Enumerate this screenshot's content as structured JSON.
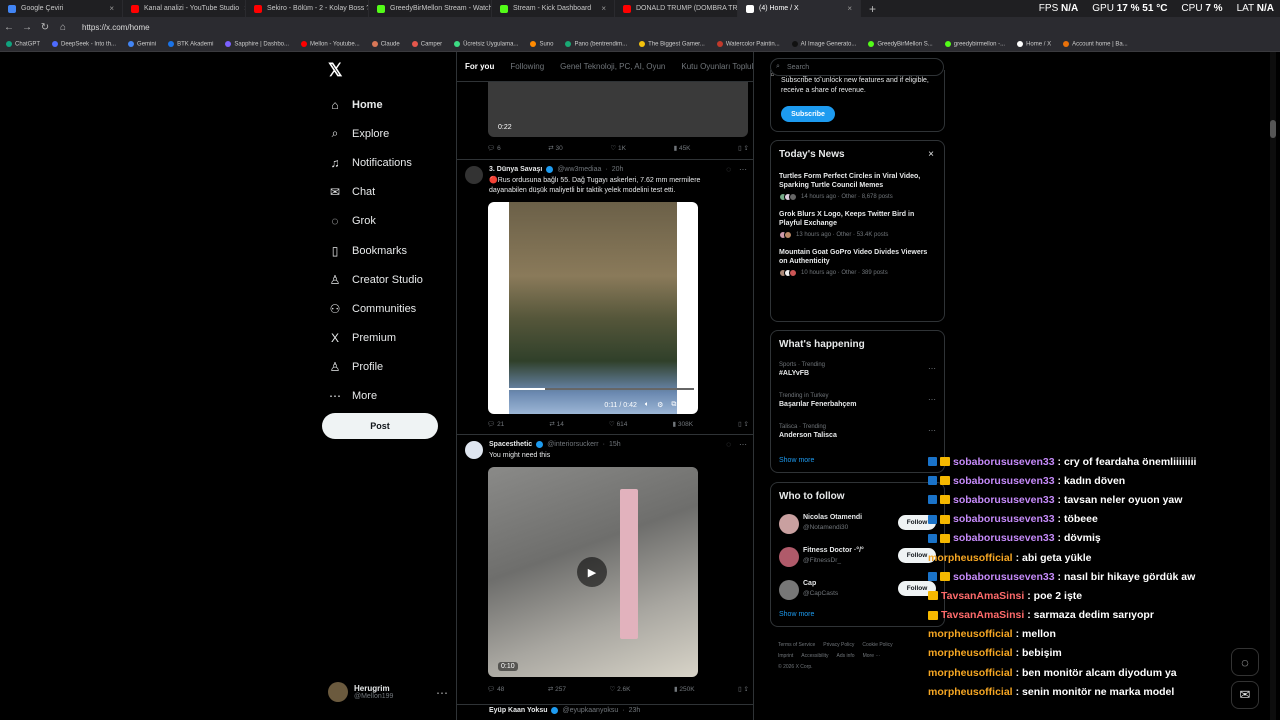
{
  "browser": {
    "tabs": [
      {
        "label": "Google Çeviri",
        "color": "#4285f4"
      },
      {
        "label": "Kanal analizi - YouTube Studio",
        "color": "#ff0000"
      },
      {
        "label": "Sekiro - Bölüm - 2 - Kolay Boss ??",
        "color": "#ff0000"
      },
      {
        "label": "GreedyBirMellon Stream - Watch",
        "color": "#53fc18"
      },
      {
        "label": "Stream - Kick Dashboard",
        "color": "#53fc18"
      },
      {
        "label": "DONALD TRUMP (DOMBRA TRAP",
        "color": "#ff0000"
      },
      {
        "label": "(4) Home / X",
        "color": "#ffffff"
      }
    ],
    "new_tab": "+",
    "url": "https://x.com/home",
    "sys": {
      "fps_label": "FPS",
      "fps": "N/A",
      "gpu_label": "GPU",
      "gpu": "17 % 51 °C",
      "cpu_label": "CPU",
      "cpu": "7 %",
      "lat_label": "LAT",
      "lat": "N/A"
    },
    "bookmarks": [
      "ChatGPT",
      "DeepSeek - Into th...",
      "Gemini",
      "BTK Akademi",
      "Sapphire | Dashbo...",
      "Mellon - Youtube...",
      "Claude",
      "Camper",
      "Ücretsiz Uygulama...",
      "Suno",
      "Pano (bentrendim...",
      "The Biggest Gamer...",
      "Watercolor Paintin...",
      "AI Image Generato...",
      "GreedyBirMellon S...",
      "greedybirmellon -...",
      "Home / X",
      "Account home | Ba..."
    ]
  },
  "sidebar": {
    "items": [
      {
        "label": "Home",
        "icon": "⌂"
      },
      {
        "label": "Explore",
        "icon": "⌕"
      },
      {
        "label": "Notifications",
        "icon": "♫"
      },
      {
        "label": "Chat",
        "icon": "✉"
      },
      {
        "label": "Grok",
        "icon": "◌"
      },
      {
        "label": "Bookmarks",
        "icon": "▯"
      },
      {
        "label": "Creator Studio",
        "icon": "♙"
      },
      {
        "label": "Communities",
        "icon": "⚇"
      },
      {
        "label": "Premium",
        "icon": "X"
      },
      {
        "label": "Profile",
        "icon": "♙"
      },
      {
        "label": "More",
        "icon": "⋯"
      }
    ],
    "post_label": "Post",
    "account": {
      "name": "Herugrim",
      "handle": "@Mellon199"
    }
  },
  "feed": {
    "tabs": [
      "For you",
      "Following",
      "Genel Teknoloji, PC, AI, Oyun",
      "Kutu Oyunları Topluluğu"
    ],
    "top": {
      "time": "0:22",
      "replies": "6",
      "reposts": "30",
      "likes": "1K",
      "views": "45K"
    },
    "t1": {
      "name": "3. Dünya Savaşı",
      "handle": "@ww3mediaa",
      "time": "20h",
      "text": "🔴Rus ordusuna bağlı 55. Dağ Tugayı askerleri, 7.62 mm mermilere dayanabilen düşük maliyetli bir taktik yelek modelini test etti.",
      "video_time": "0:11 / 0:42",
      "replies": "21",
      "reposts": "14",
      "likes": "614",
      "views": "308K",
      "progress": 0.26
    },
    "t2": {
      "name": "Spacesthetic",
      "handle": "@interiorsuckerr",
      "time": "15h",
      "text": "You might need this",
      "video_time": "0:10",
      "replies": "48",
      "reposts": "257",
      "likes": "2.6K",
      "views": "250K"
    },
    "t3": {
      "name": "Eyüp Kaan Yoksu",
      "handle": "@eyupkaanyoksu",
      "time": "23h"
    }
  },
  "right": {
    "search_placeholder": "Search",
    "subscribe_text": "Subscribe to unlock new features and if eligible, receive a share of revenue.",
    "subscribe_label": "Subscribe",
    "news_title": "Today's News",
    "news": [
      {
        "title": "Turtles Form Perfect Circles in Viral Video, Sparking Turtle Council Memes",
        "meta": "14 hours ago · Other · 8,678 posts"
      },
      {
        "title": "Grok Blurs X Logo, Keeps Twitter Bird in Playful Exchange",
        "meta": "13 hours ago · Other · 53.4K posts"
      },
      {
        "title": "Mountain Goat GoPro Video Divides Viewers on Authenticity",
        "meta": "10 hours ago · Other · 389 posts"
      }
    ],
    "happening_title": "What's happening",
    "trends": [
      {
        "cat": "Sports · Trending",
        "name": "#ALYvFB"
      },
      {
        "cat": "Trending in Turkey",
        "name": "Başarılar Fenerbahçem"
      },
      {
        "cat": "Talisca · Trending",
        "name": "Anderson Talisca"
      }
    ],
    "show_more": "Show more",
    "wtf_title": "Who to follow",
    "wtf": [
      {
        "name": "Nicolas Otamendi",
        "handle": "@Notamendi30",
        "av": "#c9a0a0"
      },
      {
        "name": "Fitness Doctor ·°/°",
        "handle": "@FitnessDr_",
        "av": "#b05a6a"
      },
      {
        "name": "Cap",
        "handle": "@CapCasts",
        "av": "#777777"
      }
    ],
    "follow_label": "Follow",
    "footer": [
      "Terms of Service",
      "Privacy Policy",
      "Cookie Policy",
      "Imprint",
      "Accessibility",
      "Ads info",
      "More ···",
      "© 2026 X Corp."
    ]
  },
  "chat": [
    {
      "user": "sobaborususeven33",
      "text": ": cry of feardaha önemliiiiiiii",
      "cls": "u1",
      "badges": 2
    },
    {
      "user": "sobaborususeven33",
      "text": ": kadın döven",
      "cls": "u1",
      "badges": 2
    },
    {
      "user": "sobaborususeven33",
      "text": ": tavsan neler oyuon yaw",
      "cls": "u1",
      "badges": 2
    },
    {
      "user": "sobaborususeven33",
      "text": ": töbeee",
      "cls": "u1",
      "badges": 2
    },
    {
      "user": "sobaborususeven33",
      "text": ": dövmiş",
      "cls": "u1",
      "badges": 2
    },
    {
      "user": "morpheusofficial",
      "text": ": abi geta yükle",
      "cls": "u2",
      "badges": 0
    },
    {
      "user": "sobaborususeven33",
      "text": ": nasıl bir hikaye gördük aw",
      "cls": "u1",
      "badges": 2
    },
    {
      "user": "TavsanAmaSinsi",
      "text": ": poe 2 işte",
      "cls": "u3",
      "badges": 1
    },
    {
      "user": "TavsanAmaSinsi",
      "text": ": sarmaza dedim sarıyopr",
      "cls": "u3",
      "badges": 1
    },
    {
      "user": "morpheusofficial",
      "text": ": mellon",
      "cls": "u2",
      "badges": 0
    },
    {
      "user": "morpheusofficial",
      "text": ": bebişim",
      "cls": "u2",
      "badges": 0
    },
    {
      "user": "morpheusofficial",
      "text": ": ben monitör alcam diyodum ya",
      "cls": "u2",
      "badges": 0
    },
    {
      "user": "morpheusofficial",
      "text": ": senin monitör ne marka model",
      "cls": "u2",
      "badges": 0
    }
  ]
}
